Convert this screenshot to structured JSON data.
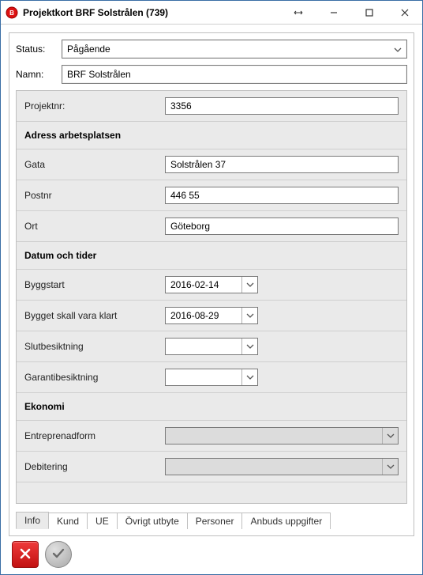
{
  "window": {
    "title": "Projektkort BRF Solstrålen (739)"
  },
  "top": {
    "status_label": "Status:",
    "status_value": "Pågående",
    "name_label": "Namn:",
    "name_value": "BRF Solstrålen"
  },
  "sections": {
    "projektnr_label": "Projektnr:",
    "projektnr_value": "3356",
    "adress_header": "Adress arbetsplatsen",
    "gata_label": "Gata",
    "gata_value": "Solstrålen 37",
    "postnr_label": "Postnr",
    "postnr_value": "446 55",
    "ort_label": "Ort",
    "ort_value": "Göteborg",
    "datum_header": "Datum och tider",
    "byggstart_label": "Byggstart",
    "byggstart_value": "2016-02-14",
    "klart_label": "Bygget skall vara klart",
    "klart_value": "2016-08-29",
    "slutb_label": "Slutbesiktning",
    "slutb_value": "",
    "garanti_label": "Garantibesiktning",
    "garanti_value": "",
    "ekonomi_header": "Ekonomi",
    "entre_label": "Entreprenadform",
    "entre_value": "",
    "deb_label": "Debitering",
    "deb_value": ""
  },
  "tabs": {
    "info": "Info",
    "kund": "Kund",
    "ue": "UE",
    "ovrigt": "Övrigt utbyte",
    "personer": "Personer",
    "anbud": "Anbuds uppgifter"
  }
}
